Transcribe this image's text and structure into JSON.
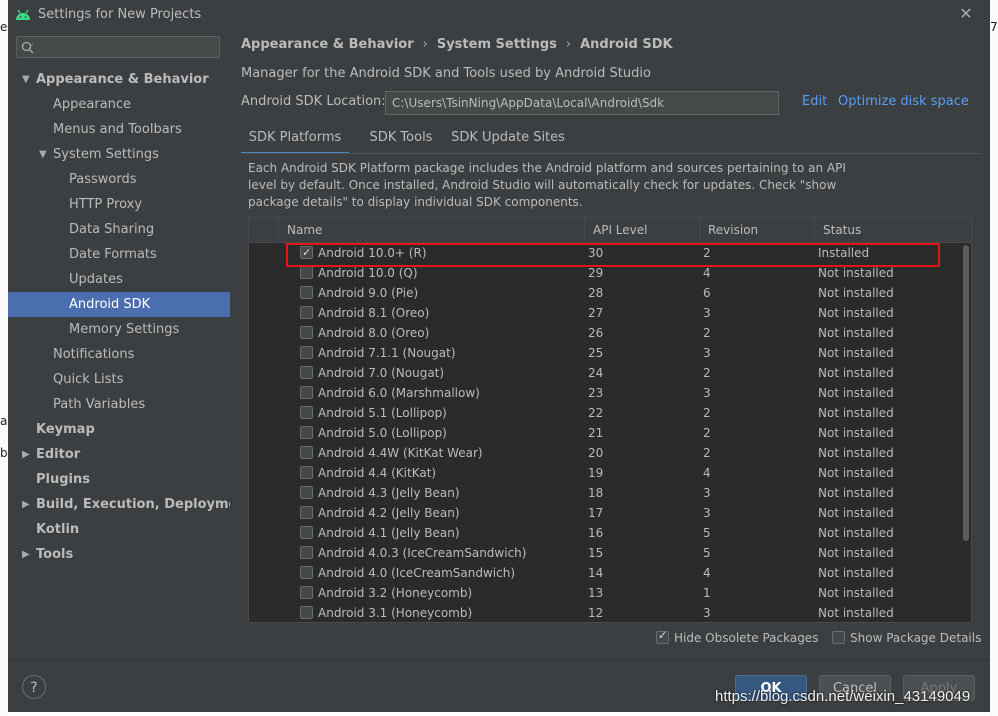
{
  "window": {
    "title": "Settings for New Projects"
  },
  "background": {
    "left_fragments": [
      "e",
      "a",
      "b"
    ],
    "right_fragment": "7"
  },
  "search": {
    "placeholder": "",
    "value": ""
  },
  "sidebar": {
    "items": [
      {
        "label": "Appearance & Behavior",
        "level": 0,
        "bold": true,
        "arrow": "down"
      },
      {
        "label": "Appearance",
        "level": 1
      },
      {
        "label": "Menus and Toolbars",
        "level": 1
      },
      {
        "label": "System Settings",
        "level": 1,
        "arrow": "down"
      },
      {
        "label": "Passwords",
        "level": 2
      },
      {
        "label": "HTTP Proxy",
        "level": 2
      },
      {
        "label": "Data Sharing",
        "level": 2
      },
      {
        "label": "Date Formats",
        "level": 2
      },
      {
        "label": "Updates",
        "level": 2
      },
      {
        "label": "Android SDK",
        "level": 2,
        "selected": true
      },
      {
        "label": "Memory Settings",
        "level": 2
      },
      {
        "label": "Notifications",
        "level": 1
      },
      {
        "label": "Quick Lists",
        "level": 1
      },
      {
        "label": "Path Variables",
        "level": 1
      },
      {
        "label": "Keymap",
        "level": 0,
        "bold": true
      },
      {
        "label": "Editor",
        "level": 0,
        "bold": true,
        "arrow": "right"
      },
      {
        "label": "Plugins",
        "level": 0,
        "bold": true
      },
      {
        "label": "Build, Execution, Deployment",
        "level": 0,
        "bold": true,
        "arrow": "right"
      },
      {
        "label": "Kotlin",
        "level": 0,
        "bold": true
      },
      {
        "label": "Tools",
        "level": 0,
        "bold": true,
        "arrow": "right"
      }
    ]
  },
  "breadcrumb": [
    "Appearance & Behavior",
    "System Settings",
    "Android SDK"
  ],
  "main": {
    "description": "Manager for the Android SDK and Tools used by Android Studio",
    "location_label": "Android SDK Location:",
    "location_value": "C:\\Users\\TsinNing\\AppData\\Local\\Android\\Sdk",
    "edit_link": "Edit",
    "optimize_link": "Optimize disk space"
  },
  "tabs": [
    {
      "label": "SDK Platforms",
      "active": true
    },
    {
      "label": "SDK Tools"
    },
    {
      "label": "SDK Update Sites"
    }
  ],
  "panel": {
    "description": "Each Android SDK Platform package includes the Android platform and sources pertaining to an API level by default. Once installed, Android Studio will automatically check for updates. Check \"show package details\" to display individual SDK components."
  },
  "table": {
    "columns": [
      "Name",
      "API Level",
      "Revision",
      "Status"
    ],
    "rows": [
      {
        "checked": true,
        "name": "Android 10.0+ (R)",
        "api": "30",
        "revision": "2",
        "status": "Installed"
      },
      {
        "checked": false,
        "name": "Android 10.0 (Q)",
        "api": "29",
        "revision": "4",
        "status": "Not installed"
      },
      {
        "checked": false,
        "name": "Android 9.0 (Pie)",
        "api": "28",
        "revision": "6",
        "status": "Not installed"
      },
      {
        "checked": false,
        "name": "Android 8.1 (Oreo)",
        "api": "27",
        "revision": "3",
        "status": "Not installed"
      },
      {
        "checked": false,
        "name": "Android 8.0 (Oreo)",
        "api": "26",
        "revision": "2",
        "status": "Not installed"
      },
      {
        "checked": false,
        "name": "Android 7.1.1 (Nougat)",
        "api": "25",
        "revision": "3",
        "status": "Not installed"
      },
      {
        "checked": false,
        "name": "Android 7.0 (Nougat)",
        "api": "24",
        "revision": "2",
        "status": "Not installed"
      },
      {
        "checked": false,
        "name": "Android 6.0 (Marshmallow)",
        "api": "23",
        "revision": "3",
        "status": "Not installed"
      },
      {
        "checked": false,
        "name": "Android 5.1 (Lollipop)",
        "api": "22",
        "revision": "2",
        "status": "Not installed"
      },
      {
        "checked": false,
        "name": "Android 5.0 (Lollipop)",
        "api": "21",
        "revision": "2",
        "status": "Not installed"
      },
      {
        "checked": false,
        "name": "Android 4.4W (KitKat Wear)",
        "api": "20",
        "revision": "2",
        "status": "Not installed"
      },
      {
        "checked": false,
        "name": "Android 4.4 (KitKat)",
        "api": "19",
        "revision": "4",
        "status": "Not installed"
      },
      {
        "checked": false,
        "name": "Android 4.3 (Jelly Bean)",
        "api": "18",
        "revision": "3",
        "status": "Not installed"
      },
      {
        "checked": false,
        "name": "Android 4.2 (Jelly Bean)",
        "api": "17",
        "revision": "3",
        "status": "Not installed"
      },
      {
        "checked": false,
        "name": "Android 4.1 (Jelly Bean)",
        "api": "16",
        "revision": "5",
        "status": "Not installed"
      },
      {
        "checked": false,
        "name": "Android 4.0.3 (IceCreamSandwich)",
        "api": "15",
        "revision": "5",
        "status": "Not installed"
      },
      {
        "checked": false,
        "name": "Android 4.0 (IceCreamSandwich)",
        "api": "14",
        "revision": "4",
        "status": "Not installed"
      },
      {
        "checked": false,
        "name": "Android 3.2 (Honeycomb)",
        "api": "13",
        "revision": "1",
        "status": "Not installed"
      },
      {
        "checked": false,
        "name": "Android 3.1 (Honeycomb)",
        "api": "12",
        "revision": "3",
        "status": "Not installed"
      }
    ]
  },
  "options": {
    "hide_obsolete": {
      "label": "Hide Obsolete Packages",
      "checked": true
    },
    "show_details": {
      "label": "Show Package Details",
      "checked": false
    }
  },
  "footer": {
    "help": "?",
    "ok": "OK",
    "cancel": "Cancel",
    "apply": "Apply"
  },
  "watermark": "https://blog.csdn.net/weixin_43149049",
  "colors": {
    "selection": "#4b6eaf",
    "link": "#589df6",
    "highlight": "#e0161b",
    "primary_button": "#365880"
  }
}
